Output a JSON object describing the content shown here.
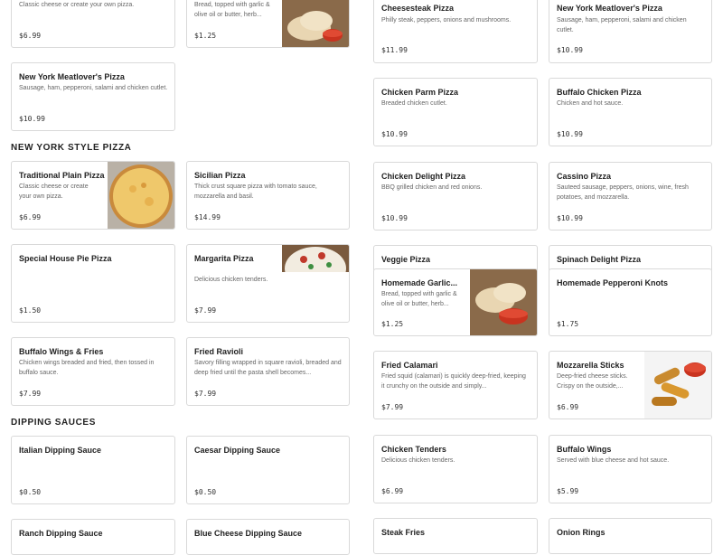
{
  "sections": {
    "new_york_style": "NEW YORK STYLE PIZZA",
    "dipping_sauces": "DIPPING SAUCES"
  },
  "items": {
    "plain_top": {
      "name": "",
      "desc": "Classic cheese or create your own pizza.",
      "price": "$6.99"
    },
    "garlic_top": {
      "name": "",
      "desc": "Bread, topped with garlic & olive oil or butter, herb...",
      "price": "$1.25"
    },
    "meatlover_left": {
      "name": "New York Meatlover's Pizza",
      "desc": "Sausage, ham, pepperoni, salami and chicken cutlet.",
      "price": "$10.99"
    },
    "traditional": {
      "name": "Traditional Plain Pizza",
      "desc": "Classic cheese or create your own pizza.",
      "price": "$6.99"
    },
    "sicilian": {
      "name": "Sicilian Pizza",
      "desc": "Thick crust square pizza with tomato sauce, mozzarella and basil.",
      "price": "$14.99"
    },
    "special_pie": {
      "name": "Special House Pie Pizza",
      "desc": "",
      "price": "$1.50"
    },
    "margarita": {
      "name": "Margarita Pizza",
      "desc": "Delicious chicken tenders.",
      "price": "$7.99"
    },
    "buffalo_fries": {
      "name": "Buffalo Wings & Fries",
      "desc": "Chicken wings breaded and fried, then tossed in buffalo sauce.",
      "price": "$7.99"
    },
    "ravioli": {
      "name": "Fried Ravioli",
      "desc": "Savory filling wrapped in square ravioli, breaded and deep fried until the pasta shell becomes...",
      "price": "$7.99"
    },
    "italian_sauce": {
      "name": "Italian Dipping Sauce",
      "desc": "",
      "price": "$0.50"
    },
    "caesar_sauce": {
      "name": "Caesar Dipping Sauce",
      "desc": "",
      "price": "$0.50"
    },
    "ranch_sauce": {
      "name": "Ranch Dipping Sauce",
      "desc": "",
      "price": ""
    },
    "bluecheese_sauce": {
      "name": "Blue Cheese Dipping Sauce",
      "desc": "",
      "price": ""
    },
    "cheesesteak": {
      "name": "Cheesesteak Pizza",
      "desc": "Philly steak, peppers, onions and mushrooms.",
      "price": "$11.99"
    },
    "meatlover_right": {
      "name": "New York Meatlover's Pizza",
      "desc": "Sausage, ham, pepperoni, salami and chicken cutlet.",
      "price": "$10.99"
    },
    "chicken_parm": {
      "name": "Chicken Parm Pizza",
      "desc": "Breaded chicken cutlet.",
      "price": "$10.99"
    },
    "buffalo_chicken": {
      "name": "Buffalo Chicken Pizza",
      "desc": "Chicken and hot sauce.",
      "price": "$10.99"
    },
    "chicken_delight": {
      "name": "Chicken Delight Pizza",
      "desc": "BBQ grilled chicken and red onions.",
      "price": "$10.99"
    },
    "cassino": {
      "name": "Cassino Pizza",
      "desc": "Sauteed sausage, peppers, onions, wine, fresh potatoes, and mozzarella.",
      "price": "$10.99"
    },
    "veggie": {
      "name": "Veggie Pizza",
      "desc": "",
      "price": ""
    },
    "spinach_delight": {
      "name": "Spinach Delight Pizza",
      "desc": "",
      "price": ""
    },
    "garlic_knots": {
      "name": "Homemade Garlic...",
      "desc": "Bread, topped with garlic & olive oil or butter, herb...",
      "price": "$1.25"
    },
    "pepperoni_knots": {
      "name": "Homemade Pepperoni Knots",
      "desc": "",
      "price": "$1.75"
    },
    "calamari": {
      "name": "Fried Calamari",
      "desc": "Fried squid (calamari) is quickly deep-fried, keeping it crunchy on the outside and simply...",
      "price": "$7.99"
    },
    "mozzarella": {
      "name": "Mozzarella Sticks",
      "desc": "Deep-fried cheese sticks. Crispy on the outside,...",
      "price": "$6.99"
    },
    "chicken_tenders": {
      "name": "Chicken Tenders",
      "desc": "Delicious chicken tenders.",
      "price": "$6.99"
    },
    "buffalo_wings": {
      "name": "Buffalo Wings",
      "desc": "Served with blue cheese and hot sauce.",
      "price": "$5.99"
    },
    "steak_fries": {
      "name": "Steak Fries",
      "desc": "",
      "price": ""
    },
    "onion_rings": {
      "name": "Onion Rings",
      "desc": "",
      "price": ""
    }
  },
  "colors": {
    "border": "#d9d9d9",
    "text": "#222222",
    "muted": "#666666",
    "crust": "#d9a24f",
    "cheese": "#f2d27a"
  }
}
